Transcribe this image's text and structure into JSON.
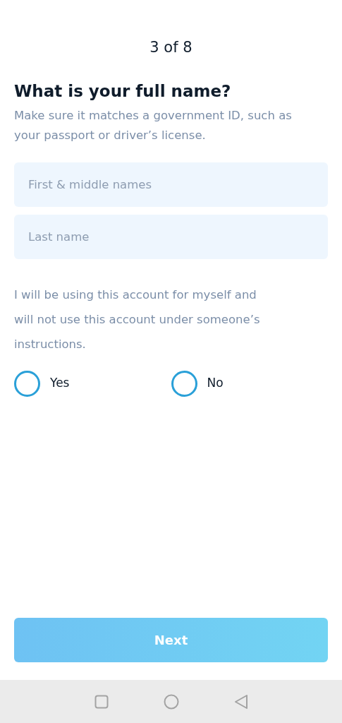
{
  "step": "3 of 8",
  "title": "What is your full name?",
  "subtitle": "Make sure it matches a government ID, such as your passport or driver’s license.",
  "fields": [
    {
      "placeholder": "First & middle names"
    },
    {
      "placeholder": "Last name"
    }
  ],
  "statement": "I will be using this account for myself and will not use this account under someone’s instructions.",
  "options": [
    {
      "label": "Yes",
      "selected": false
    },
    {
      "label": "No",
      "selected": false
    }
  ],
  "next_button": {
    "label": "Next",
    "disabled": true
  }
}
